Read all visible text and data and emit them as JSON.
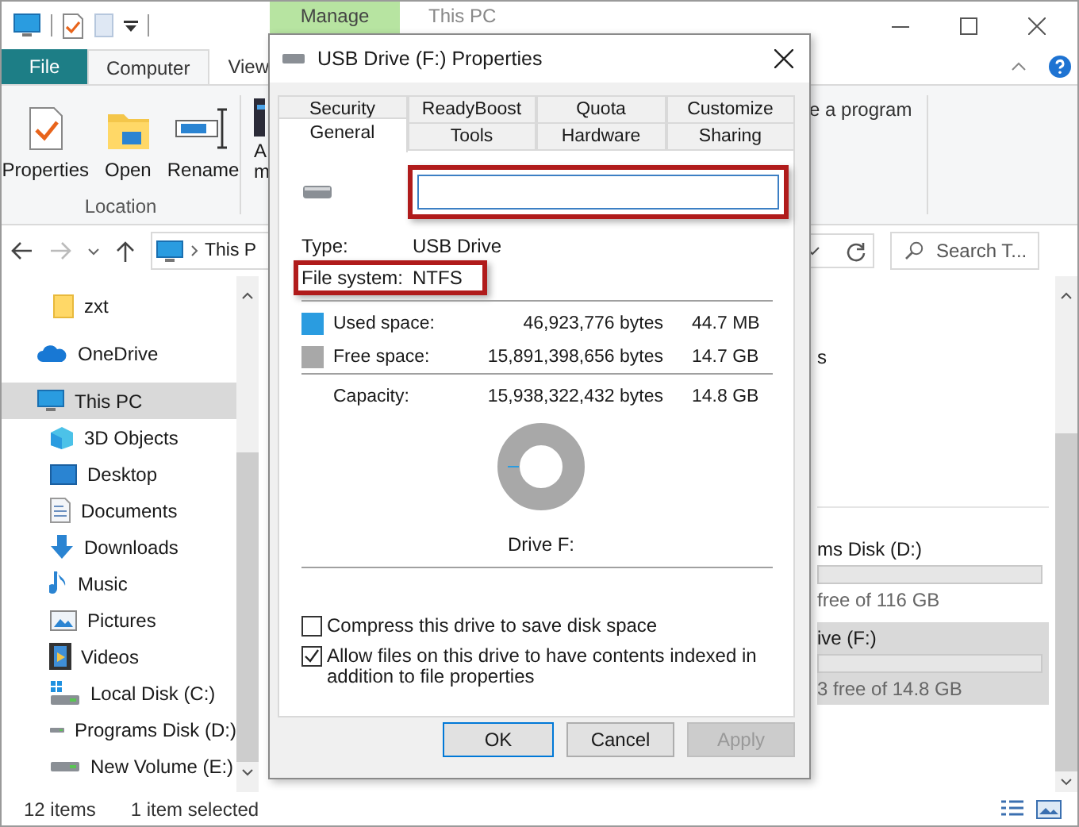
{
  "explorer": {
    "title": "This PC",
    "context_tab": "Manage",
    "ribbon_tabs": [
      {
        "label": "File",
        "kind": "file",
        "selected": false
      },
      {
        "label": "Computer",
        "kind": "tab",
        "selected": true
      },
      {
        "label": "View",
        "kind": "tab",
        "selected": false
      }
    ],
    "ribbon_groups": [
      {
        "label": "Location",
        "buttons": [
          {
            "label": "Properties",
            "kind": "properties"
          },
          {
            "label": "Open",
            "kind": "open"
          },
          {
            "label": "Rename",
            "kind": "rename"
          }
        ]
      }
    ],
    "ribbon_partial_label": [
      "A",
      "m"
    ],
    "ribbon_right_label": "e a program",
    "address": {
      "path": "This P"
    },
    "search": {
      "placeholder": "Search T..."
    },
    "nav_items": [
      {
        "label": "zxt",
        "kind": "folder",
        "selected": false
      },
      {
        "label": "OneDrive",
        "kind": "cloud",
        "selected": false
      },
      {
        "label": "This PC",
        "kind": "pc",
        "selected": true,
        "children": [
          {
            "label": "3D Objects",
            "kind": "cube",
            "selected": false
          },
          {
            "label": "Desktop",
            "kind": "desktop",
            "selected": false
          },
          {
            "label": "Documents",
            "kind": "document",
            "selected": false
          },
          {
            "label": "Downloads",
            "kind": "download",
            "selected": false
          },
          {
            "label": "Music",
            "kind": "music",
            "selected": false
          },
          {
            "label": "Pictures",
            "kind": "pictures",
            "selected": false
          },
          {
            "label": "Videos",
            "kind": "videos",
            "selected": false
          },
          {
            "label": "Local Disk (C:)",
            "kind": "system_disk",
            "selected": false
          },
          {
            "label": "Programs Disk (D:)",
            "kind": "disk",
            "selected": false
          },
          {
            "label": "New Volume (E:)",
            "kind": "disk",
            "selected": false
          }
        ]
      }
    ],
    "content": {
      "fragment": "s",
      "drives": [
        {
          "name": "ms Disk (D:)",
          "free": "free of 116 GB",
          "selected": false
        },
        {
          "name": "ive (F:)",
          "free": "3 free of 14.8 GB",
          "selected": true
        }
      ]
    },
    "status_bar": {
      "item_count": "12 items",
      "selection": "1 item selected"
    }
  },
  "dialog": {
    "title": "USB Drive (F:) Properties",
    "tab_rows": [
      [
        {
          "label": "Security",
          "selected": false
        },
        {
          "label": "ReadyBoost",
          "selected": false
        },
        {
          "label": "Quota",
          "selected": false
        },
        {
          "label": "Customize",
          "selected": false
        }
      ],
      [
        {
          "label": "General",
          "selected": true
        },
        {
          "label": "Tools",
          "selected": false
        },
        {
          "label": "Hardware",
          "selected": false
        },
        {
          "label": "Sharing",
          "selected": false
        }
      ]
    ],
    "name_field": {
      "highlighted": true
    },
    "type": {
      "label": "Type:",
      "value": "USB Drive"
    },
    "file_system": {
      "label": "File system:",
      "value": "NTFS",
      "highlighted": true
    },
    "space": [
      {
        "label": "Used space:",
        "bytes": "46,923,776 bytes",
        "size": "44.7 MB",
        "color": "#2a9ce0"
      },
      {
        "label": "Free space:",
        "bytes": "15,891,398,656 bytes",
        "size": "14.7 GB",
        "color": "#a8a8a8"
      }
    ],
    "capacity": {
      "label": "Capacity:",
      "bytes": "15,938,322,432 bytes",
      "size": "14.8 GB"
    },
    "drive_label": "Drive F:",
    "options": [
      {
        "label": "Compress this drive to save disk space",
        "checked": false
      },
      {
        "label": "Allow files on this drive to have contents indexed in addition to file properties",
        "checked": true
      }
    ],
    "buttons": [
      {
        "label": "OK",
        "kind": "default",
        "disabled": false
      },
      {
        "label": "Cancel",
        "kind": "normal",
        "disabled": false
      },
      {
        "label": "Apply",
        "kind": "normal",
        "disabled": true
      }
    ]
  }
}
